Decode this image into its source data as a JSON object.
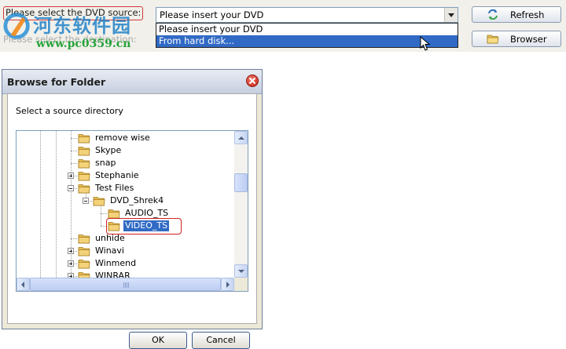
{
  "source": {
    "label": "Please select the DVD source:",
    "value": "Please insert your DVD",
    "options": [
      "Please insert your DVD",
      "From hard disk..."
    ],
    "highlighted_option": "From hard disk..."
  },
  "destination": {
    "label": "Please select the destination:"
  },
  "buttons": {
    "refresh": "Refresh",
    "browser": "Browser"
  },
  "watermark": {
    "text": "河东软件园",
    "url": "www.pc0359.cn"
  },
  "dialog": {
    "title": "Browse for Folder",
    "prompt": "Select a source directory",
    "ok": "OK",
    "cancel": "Cancel",
    "tree": [
      {
        "label": "remove wise",
        "expander": "none"
      },
      {
        "label": "Skype",
        "expander": "none"
      },
      {
        "label": "snap",
        "expander": "none"
      },
      {
        "label": "Stephanie",
        "expander": "plus"
      },
      {
        "label": "Test Files",
        "expander": "minus"
      },
      {
        "label": "DVD_Shrek4",
        "expander": "minus"
      },
      {
        "label": "AUDIO_TS",
        "expander": "none"
      },
      {
        "label": "VIDEO_TS",
        "expander": "none",
        "selected": true
      },
      {
        "label": "unhide",
        "expander": "none"
      },
      {
        "label": "Winavi",
        "expander": "plus"
      },
      {
        "label": "Winmend",
        "expander": "plus"
      },
      {
        "label": "WINRAR",
        "expander": "plus"
      }
    ]
  },
  "icons": {
    "refresh": "refresh-icon",
    "browser": "folder-icon",
    "close": "close-icon",
    "folder": "folder-icon"
  },
  "colors": {
    "selection": "#316ac5",
    "highlight_ring": "#d02020",
    "folder": "#f3d27a"
  }
}
